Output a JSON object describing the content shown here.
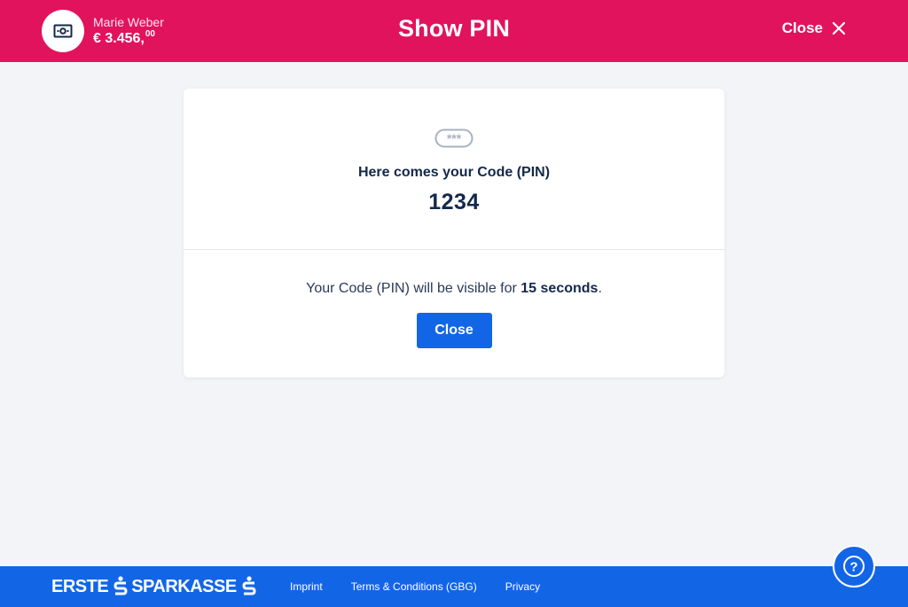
{
  "header": {
    "account_name": "Marie Weber",
    "account_balance_main": "€ 3.456,",
    "account_balance_cents": "00",
    "title": "Show PIN",
    "close_label": "Close",
    "color": "#e1135c"
  },
  "card": {
    "pin_icon": "pin-asterisks-icon",
    "pin_icon_text": "***",
    "heading": "Here comes your Code (PIN)",
    "pin": "1234",
    "note_prefix": "Your Code (PIN) will be visible for ",
    "note_emphasis": "15 seconds",
    "note_suffix": ".",
    "close_button": "Close"
  },
  "footer": {
    "brand_erste": "ERSTE",
    "brand_sparkasse": "SPARKASSE",
    "links": [
      "Imprint",
      "Terms & Conditions (GBG)",
      "Privacy"
    ],
    "color": "#1266e6"
  },
  "help": {
    "icon": "question-mark-icon",
    "label": "?"
  }
}
